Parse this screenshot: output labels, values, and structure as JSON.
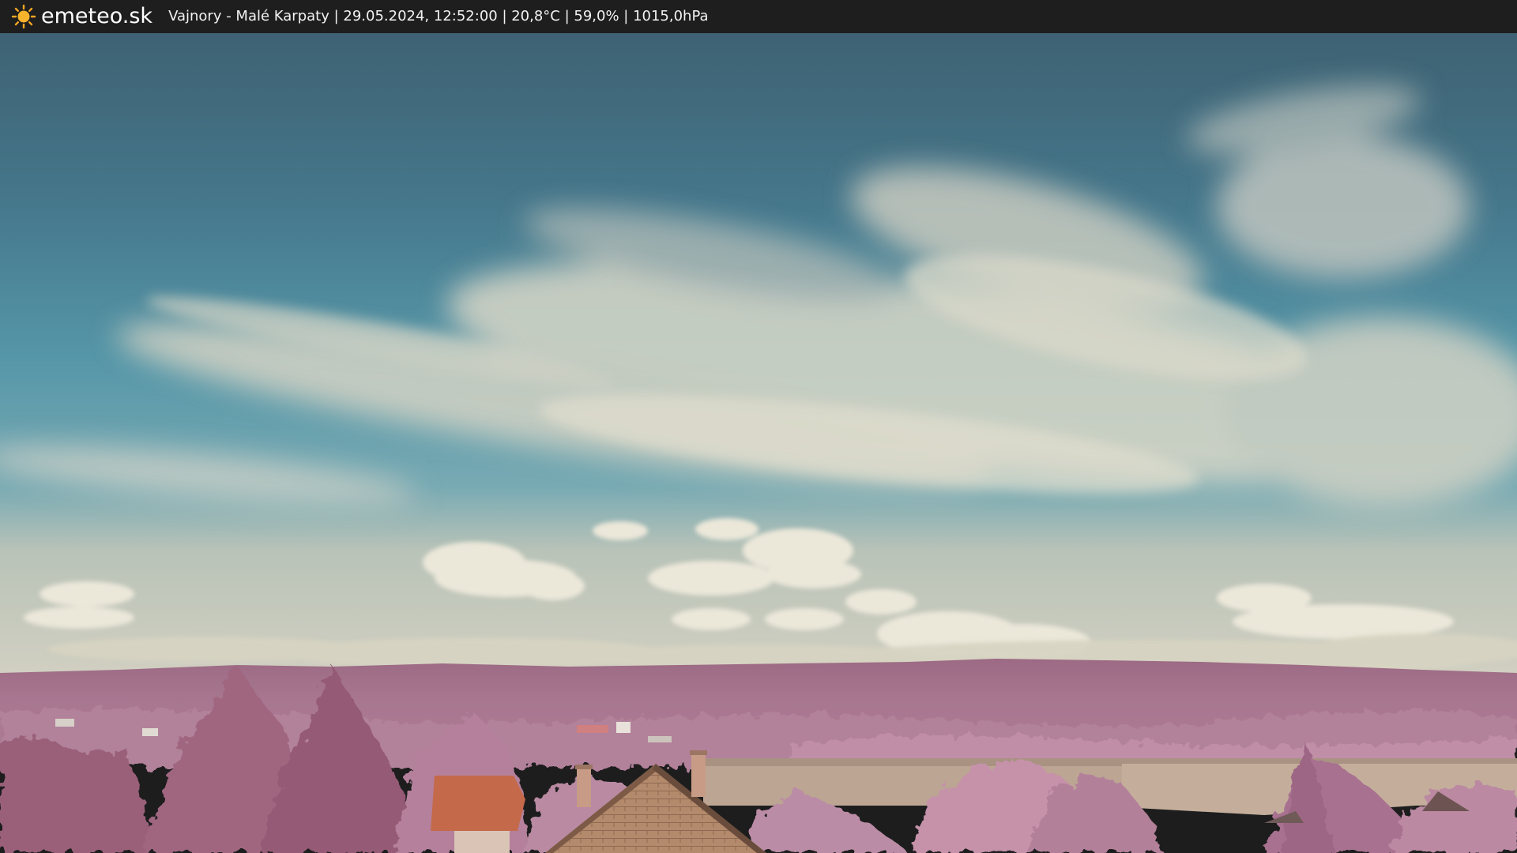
{
  "header": {
    "brand": "emeteo.sk",
    "caption": "Vajnory - Malé Karpaty | 29.05.2024, 12:52:00 | 20,8°C | 59,0% | 1015,0hPa",
    "logo_icon": "sun-icon"
  },
  "colors": {
    "bar_background": "#1e1e1e",
    "sun": "#f5a623",
    "sky_top": "#3f6577",
    "sky_mid": "#4f8fa2",
    "cloud": "#ddd9c8",
    "vegetation": "#b07d98",
    "roof": "#c9704e",
    "field": "#b9a191"
  }
}
